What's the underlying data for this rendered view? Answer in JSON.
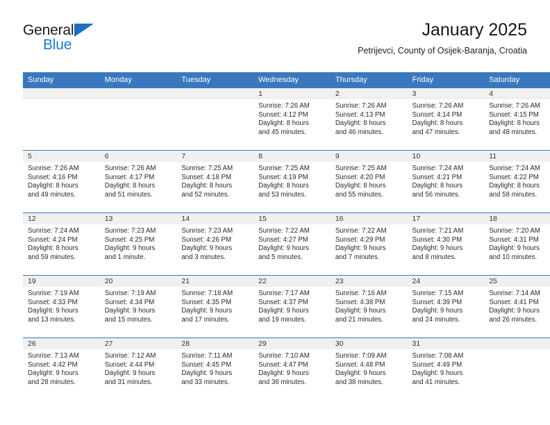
{
  "branding": {
    "logo_primary": "General",
    "logo_secondary": "Blue",
    "logo_triangle_color": "#1d6fc0",
    "logo_secondary_color": "#1d7ad1"
  },
  "header": {
    "title": "January 2025",
    "subtitle": "Petrijevci, County of Osijek-Baranja, Croatia"
  },
  "theme": {
    "header_row_bg": "#3a78bd",
    "header_row_text": "#ffffff",
    "daynum_band_bg": "#f0f0f0",
    "row_divider": "#3a78bd",
    "page_bg": "#ffffff"
  },
  "calendar": {
    "weekday_headers": [
      "Sunday",
      "Monday",
      "Tuesday",
      "Wednesday",
      "Thursday",
      "Friday",
      "Saturday"
    ],
    "weeks": [
      [
        {
          "day": "",
          "lines": []
        },
        {
          "day": "",
          "lines": []
        },
        {
          "day": "",
          "lines": []
        },
        {
          "day": "1",
          "lines": [
            "Sunrise: 7:26 AM",
            "Sunset: 4:12 PM",
            "Daylight: 8 hours",
            "and 45 minutes."
          ]
        },
        {
          "day": "2",
          "lines": [
            "Sunrise: 7:26 AM",
            "Sunset: 4:13 PM",
            "Daylight: 8 hours",
            "and 46 minutes."
          ]
        },
        {
          "day": "3",
          "lines": [
            "Sunrise: 7:26 AM",
            "Sunset: 4:14 PM",
            "Daylight: 8 hours",
            "and 47 minutes."
          ]
        },
        {
          "day": "4",
          "lines": [
            "Sunrise: 7:26 AM",
            "Sunset: 4:15 PM",
            "Daylight: 8 hours",
            "and 48 minutes."
          ]
        }
      ],
      [
        {
          "day": "5",
          "lines": [
            "Sunrise: 7:26 AM",
            "Sunset: 4:16 PM",
            "Daylight: 8 hours",
            "and 49 minutes."
          ]
        },
        {
          "day": "6",
          "lines": [
            "Sunrise: 7:26 AM",
            "Sunset: 4:17 PM",
            "Daylight: 8 hours",
            "and 51 minutes."
          ]
        },
        {
          "day": "7",
          "lines": [
            "Sunrise: 7:25 AM",
            "Sunset: 4:18 PM",
            "Daylight: 8 hours",
            "and 52 minutes."
          ]
        },
        {
          "day": "8",
          "lines": [
            "Sunrise: 7:25 AM",
            "Sunset: 4:19 PM",
            "Daylight: 8 hours",
            "and 53 minutes."
          ]
        },
        {
          "day": "9",
          "lines": [
            "Sunrise: 7:25 AM",
            "Sunset: 4:20 PM",
            "Daylight: 8 hours",
            "and 55 minutes."
          ]
        },
        {
          "day": "10",
          "lines": [
            "Sunrise: 7:24 AM",
            "Sunset: 4:21 PM",
            "Daylight: 8 hours",
            "and 56 minutes."
          ]
        },
        {
          "day": "11",
          "lines": [
            "Sunrise: 7:24 AM",
            "Sunset: 4:22 PM",
            "Daylight: 8 hours",
            "and 58 minutes."
          ]
        }
      ],
      [
        {
          "day": "12",
          "lines": [
            "Sunrise: 7:24 AM",
            "Sunset: 4:24 PM",
            "Daylight: 8 hours",
            "and 59 minutes."
          ]
        },
        {
          "day": "13",
          "lines": [
            "Sunrise: 7:23 AM",
            "Sunset: 4:25 PM",
            "Daylight: 9 hours",
            "and 1 minute."
          ]
        },
        {
          "day": "14",
          "lines": [
            "Sunrise: 7:23 AM",
            "Sunset: 4:26 PM",
            "Daylight: 9 hours",
            "and 3 minutes."
          ]
        },
        {
          "day": "15",
          "lines": [
            "Sunrise: 7:22 AM",
            "Sunset: 4:27 PM",
            "Daylight: 9 hours",
            "and 5 minutes."
          ]
        },
        {
          "day": "16",
          "lines": [
            "Sunrise: 7:22 AM",
            "Sunset: 4:29 PM",
            "Daylight: 9 hours",
            "and 7 minutes."
          ]
        },
        {
          "day": "17",
          "lines": [
            "Sunrise: 7:21 AM",
            "Sunset: 4:30 PM",
            "Daylight: 9 hours",
            "and 8 minutes."
          ]
        },
        {
          "day": "18",
          "lines": [
            "Sunrise: 7:20 AM",
            "Sunset: 4:31 PM",
            "Daylight: 9 hours",
            "and 10 minutes."
          ]
        }
      ],
      [
        {
          "day": "19",
          "lines": [
            "Sunrise: 7:19 AM",
            "Sunset: 4:33 PM",
            "Daylight: 9 hours",
            "and 13 minutes."
          ]
        },
        {
          "day": "20",
          "lines": [
            "Sunrise: 7:19 AM",
            "Sunset: 4:34 PM",
            "Daylight: 9 hours",
            "and 15 minutes."
          ]
        },
        {
          "day": "21",
          "lines": [
            "Sunrise: 7:18 AM",
            "Sunset: 4:35 PM",
            "Daylight: 9 hours",
            "and 17 minutes."
          ]
        },
        {
          "day": "22",
          "lines": [
            "Sunrise: 7:17 AM",
            "Sunset: 4:37 PM",
            "Daylight: 9 hours",
            "and 19 minutes."
          ]
        },
        {
          "day": "23",
          "lines": [
            "Sunrise: 7:16 AM",
            "Sunset: 4:38 PM",
            "Daylight: 9 hours",
            "and 21 minutes."
          ]
        },
        {
          "day": "24",
          "lines": [
            "Sunrise: 7:15 AM",
            "Sunset: 4:39 PM",
            "Daylight: 9 hours",
            "and 24 minutes."
          ]
        },
        {
          "day": "25",
          "lines": [
            "Sunrise: 7:14 AM",
            "Sunset: 4:41 PM",
            "Daylight: 9 hours",
            "and 26 minutes."
          ]
        }
      ],
      [
        {
          "day": "26",
          "lines": [
            "Sunrise: 7:13 AM",
            "Sunset: 4:42 PM",
            "Daylight: 9 hours",
            "and 28 minutes."
          ]
        },
        {
          "day": "27",
          "lines": [
            "Sunrise: 7:12 AM",
            "Sunset: 4:44 PM",
            "Daylight: 9 hours",
            "and 31 minutes."
          ]
        },
        {
          "day": "28",
          "lines": [
            "Sunrise: 7:11 AM",
            "Sunset: 4:45 PM",
            "Daylight: 9 hours",
            "and 33 minutes."
          ]
        },
        {
          "day": "29",
          "lines": [
            "Sunrise: 7:10 AM",
            "Sunset: 4:47 PM",
            "Daylight: 9 hours",
            "and 36 minutes."
          ]
        },
        {
          "day": "30",
          "lines": [
            "Sunrise: 7:09 AM",
            "Sunset: 4:48 PM",
            "Daylight: 9 hours",
            "and 38 minutes."
          ]
        },
        {
          "day": "31",
          "lines": [
            "Sunrise: 7:08 AM",
            "Sunset: 4:49 PM",
            "Daylight: 9 hours",
            "and 41 minutes."
          ]
        },
        {
          "day": "",
          "lines": []
        }
      ]
    ]
  }
}
